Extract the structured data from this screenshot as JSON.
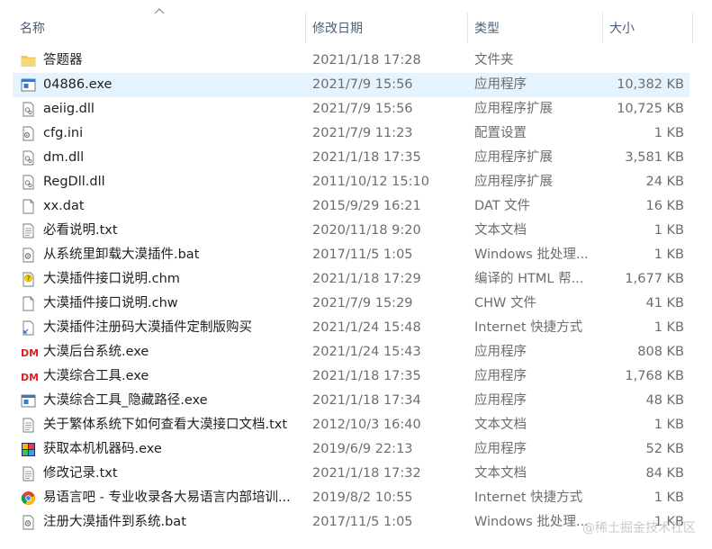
{
  "header": {
    "columns": [
      "名称",
      "修改日期",
      "类型",
      "大小"
    ]
  },
  "files": [
    {
      "name": "答题器",
      "date": "2021/1/18 17:28",
      "type": "文件夹",
      "size": "",
      "icon": "folder-icon"
    },
    {
      "name": "04886.exe",
      "date": "2021/7/9 15:56",
      "type": "应用程序",
      "size": "10,382 KB",
      "icon": "exe-icon",
      "selected": true
    },
    {
      "name": "aeiig.dll",
      "date": "2021/7/9 15:56",
      "type": "应用程序扩展",
      "size": "10,725 KB",
      "icon": "dll-icon"
    },
    {
      "name": "cfg.ini",
      "date": "2021/7/9 11:23",
      "type": "配置设置",
      "size": "1 KB",
      "icon": "ini-icon"
    },
    {
      "name": "dm.dll",
      "date": "2021/1/18 17:35",
      "type": "应用程序扩展",
      "size": "3,581 KB",
      "icon": "dll-icon"
    },
    {
      "name": "RegDll.dll",
      "date": "2011/10/12 15:10",
      "type": "应用程序扩展",
      "size": "24 KB",
      "icon": "dll-icon"
    },
    {
      "name": "xx.dat",
      "date": "2015/9/29 16:21",
      "type": "DAT 文件",
      "size": "16 KB",
      "icon": "file-icon"
    },
    {
      "name": "必看说明.txt",
      "date": "2020/11/18 9:20",
      "type": "文本文档",
      "size": "1 KB",
      "icon": "txt-icon"
    },
    {
      "name": "从系统里卸载大漠插件.bat",
      "date": "2017/11/5 1:05",
      "type": "Windows 批处理...",
      "size": "1 KB",
      "icon": "bat-icon"
    },
    {
      "name": "大漠插件接口说明.chm",
      "date": "2021/1/18 17:29",
      "type": "编译的 HTML 帮...",
      "size": "1,677 KB",
      "icon": "chm-icon"
    },
    {
      "name": "大漠插件接口说明.chw",
      "date": "2021/7/9 15:29",
      "type": "CHW 文件",
      "size": "41 KB",
      "icon": "file-icon"
    },
    {
      "name": "大漠插件注册码大漠插件定制版购买",
      "date": "2021/1/24 15:48",
      "type": "Internet 快捷方式",
      "size": "1 KB",
      "icon": "url-icon"
    },
    {
      "name": "大漠后台系统.exe",
      "date": "2021/1/24 15:43",
      "type": "应用程序",
      "size": "808 KB",
      "icon": "dm-icon"
    },
    {
      "name": "大漠综合工具.exe",
      "date": "2021/1/18 17:35",
      "type": "应用程序",
      "size": "1,768 KB",
      "icon": "dm-icon"
    },
    {
      "name": "大漠综合工具_隐藏路径.exe",
      "date": "2021/1/18 17:34",
      "type": "应用程序",
      "size": "48 KB",
      "icon": "exe-icon"
    },
    {
      "name": "关于繁体系统下如何查看大漠接口文档.txt",
      "date": "2012/10/3 16:40",
      "type": "文本文档",
      "size": "1 KB",
      "icon": "txt-icon"
    },
    {
      "name": "获取本机机器码.exe",
      "date": "2019/6/9 22:13",
      "type": "应用程序",
      "size": "52 KB",
      "icon": "app-color-icon"
    },
    {
      "name": "修改记录.txt",
      "date": "2021/1/18 17:32",
      "type": "文本文档",
      "size": "84 KB",
      "icon": "txt-icon"
    },
    {
      "name": "易语言吧 - 专业收录各大易语言内部培训...",
      "date": "2019/8/2 10:55",
      "type": "Internet 快捷方式",
      "size": "1 KB",
      "icon": "chrome-icon"
    },
    {
      "name": "注册大漠插件到系统.bat",
      "date": "2017/11/5 1:05",
      "type": "Windows 批处理...",
      "size": "1 KB",
      "icon": "bat-icon"
    }
  ],
  "watermark": "@稀土掘金技术社区",
  "colors": {
    "selected_row": "#e5f3ff",
    "header_text": "#4c607a",
    "folder": "#f2c94c",
    "dm_red": "#e02020"
  }
}
